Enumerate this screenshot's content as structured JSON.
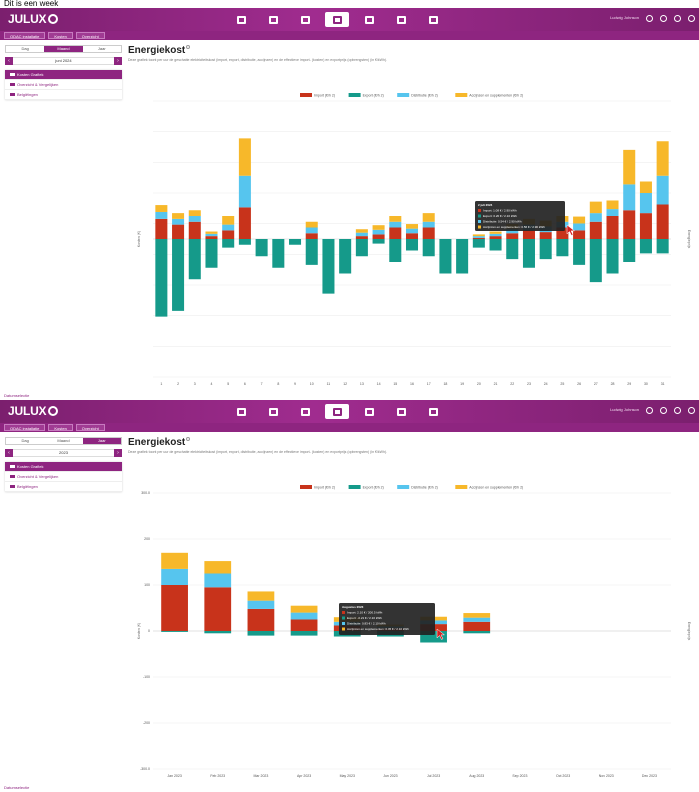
{
  "caption": "Dit is een week",
  "colors": {
    "import_dal": "#c8331b",
    "export_dal": "#159a8a",
    "distributie": "#56c5ee",
    "supplement": "#f7b82a",
    "brand": "#8e2580"
  },
  "app": {
    "logo": "JULUX"
  },
  "nav_icons": [
    "dashboard-icon",
    "chart-icon",
    "meter-icon",
    "cost-icon",
    "bill-icon",
    "plug-icon",
    "gear-icon"
  ],
  "user": {
    "name": "Ludwig Johnson"
  },
  "breadcrumbs": [
    "ODAC installatie",
    "Kosten",
    "Overzicht"
  ],
  "panes": [
    {
      "period_tabs": [
        "Dag",
        "Maand",
        "Jaar"
      ],
      "active_tab": 1,
      "date_label": "juni 2024",
      "menu": [
        "Kosten Grafiek",
        "Overzicht & Vergelijken",
        "Belgiëingen"
      ],
      "title": "Energiekost",
      "description": "Deze grafiek toont per uur de geschatte elektriciteitskost (import, export, distributie, accijnzen) en de effectieve import- (kosten) en exportprijs (opbrengsten) (in €/kWh).",
      "legend": [
        "Import (€/h 2)",
        "Export (€/h 2)",
        "Distributie (€/h 2)",
        "Accijnzen en supplementen (€/h 2)"
      ],
      "footer": "Datumselectie",
      "chart_data": {
        "type": "bar",
        "stacked": true,
        "categories": [
          "1",
          "2",
          "3",
          "4",
          "5",
          "6",
          "7",
          "8",
          "9",
          "10",
          "11",
          "12",
          "13",
          "14",
          "15",
          "16",
          "17",
          "18",
          "19",
          "20",
          "21",
          "22",
          "23",
          "24",
          "25",
          "26",
          "27",
          "28",
          "29",
          "30",
          "31"
        ],
        "ylim": [
          -2.4,
          2.4
        ],
        "yticks": [
          "",
          "",
          "",
          "",
          "",
          "",
          "",
          "",
          "",
          ""
        ],
        "ylabel": "Kosten (€)",
        "y2label": "Energieprijs",
        "y2ticks": [
          "",
          "",
          "",
          "",
          "",
          "",
          "",
          "",
          "",
          ""
        ],
        "series": [
          {
            "name": "Import (€/h 2)",
            "color": "#c8331b",
            "values": [
              0.35,
              0.25,
              0.3,
              0.05,
              0.15,
              0.55,
              0,
              0,
              0,
              0.1,
              0,
              0,
              0.05,
              0.08,
              0.2,
              0.1,
              0.2,
              0,
              0,
              0.02,
              0.05,
              0.1,
              0.15,
              0.12,
              0.2,
              0.15,
              0.3,
              0.4,
              0.5,
              0.45,
              0.6
            ]
          },
          {
            "name": "Export (€/h 2)",
            "color": "#159a8a",
            "values": [
              -1.35,
              -1.25,
              -0.7,
              -0.5,
              -0.15,
              -0.1,
              -0.3,
              -0.5,
              -0.1,
              -0.45,
              -0.95,
              -0.6,
              -0.3,
              -0.08,
              -0.4,
              -0.2,
              -0.3,
              -0.6,
              -0.6,
              -0.15,
              -0.2,
              -0.35,
              -0.5,
              -0.35,
              -0.3,
              -0.45,
              -0.75,
              -0.6,
              -0.4,
              -0.25,
              -0.25
            ]
          },
          {
            "name": "Distributie (€/h 2)",
            "color": "#56c5ee",
            "values": [
              0.12,
              0.1,
              0.1,
              0.04,
              0.1,
              0.55,
              0,
              0,
              0,
              0.1,
              0,
              0,
              0.06,
              0.08,
              0.1,
              0.08,
              0.1,
              0,
              0,
              0.03,
              0.04,
              0.08,
              0.1,
              0.1,
              0.1,
              0.12,
              0.15,
              0.12,
              0.45,
              0.35,
              0.5
            ]
          },
          {
            "name": "Accijnzen en supplementen (€/h 2)",
            "color": "#f7b82a",
            "values": [
              0.12,
              0.1,
              0.1,
              0.04,
              0.15,
              0.65,
              0,
              0,
              0,
              0.1,
              0,
              0,
              0.06,
              0.08,
              0.1,
              0.08,
              0.15,
              0,
              0,
              0.03,
              0.04,
              0.08,
              0.1,
              0.1,
              0.1,
              0.12,
              0.2,
              0.15,
              0.6,
              0.2,
              0.6
            ]
          }
        ],
        "tooltip": {
          "title": "2 juli 2024",
          "lines": [
            "Import: 1.08 € / 2.90 kWh",
            "Export: 0.20 € / 2.10 kWh",
            "Distributie: 0.54 € / 2.90 kWh",
            "Accijnzen en supplementen: 0.56 € / 2.90 kWh"
          ]
        }
      }
    },
    {
      "period_tabs": [
        "Dag",
        "Maand",
        "Jaar"
      ],
      "active_tab": 2,
      "date_label": "2023",
      "menu": [
        "Kosten Grafiek",
        "Overzicht & Vergelijken",
        "Belgiëingen"
      ],
      "title": "Energiekost",
      "description": "Deze grafiek toont per uur de geschatte elektriciteitskost (import, export, distributie, accijnzen) en de effectieve import- (kosten) en exportprijs (opbrengsten) (in €/kWh).",
      "legend": [
        "Import (€/h 2)",
        "Export (€/h 2)",
        "Distributie (€/h 2)",
        "Accijnzen en supplementen (€/h 2)"
      ],
      "footer": "Datumselectie",
      "chart_data": {
        "type": "bar",
        "stacked": true,
        "categories": [
          "Jan 2023",
          "Feb 2023",
          "Mar 2023",
          "Apr 2023",
          "May 2023",
          "Jun 2023",
          "Jul 2023",
          "Aug 2023",
          "Sep 2023",
          "Oct 2023",
          "Nov 2023",
          "Dec 2023"
        ],
        "ylim": [
          -300,
          300
        ],
        "yticks": [
          "300.0",
          "200",
          "100",
          "0",
          "-100",
          "-200",
          "-300.0"
        ],
        "ylabel": "Kosten (€)",
        "y2label": "Energieprijs",
        "y2ticks": [
          "",
          "",
          "",
          "",
          "",
          "",
          ""
        ],
        "series": [
          {
            "name": "Import (€/h 2)",
            "color": "#c8331b",
            "values": [
              100,
              95,
              48,
              25,
              12,
              6,
              15,
              20,
              0,
              0,
              0,
              0
            ]
          },
          {
            "name": "Export (€/h 2)",
            "color": "#159a8a",
            "values": [
              -2,
              -5,
              -10,
              -10,
              -12,
              -12,
              -25,
              -5,
              0,
              0,
              0,
              0
            ]
          },
          {
            "name": "Distributie (€/h 2)",
            "color": "#56c5ee",
            "values": [
              35,
              30,
              18,
              15,
              8,
              4,
              8,
              9,
              0,
              0,
              0,
              0
            ]
          },
          {
            "name": "Accijnzen en supplementen (€/h 2)",
            "color": "#f7b82a",
            "values": [
              35,
              27,
              20,
              15,
              10,
              4,
              8,
              10,
              0,
              0,
              0,
              0
            ]
          }
        ],
        "tooltip": {
          "title": "Augustus 2023",
          "lines": [
            "Import: 2.10 € / 200.5 kWh",
            "Export: -0.21 € / 2.10 kWh",
            "Distributie: 0.83 € / 2.10 kWh",
            "Accijnzen en supplementen: 0.45 € / 2.10 kWh"
          ]
        }
      }
    }
  ]
}
